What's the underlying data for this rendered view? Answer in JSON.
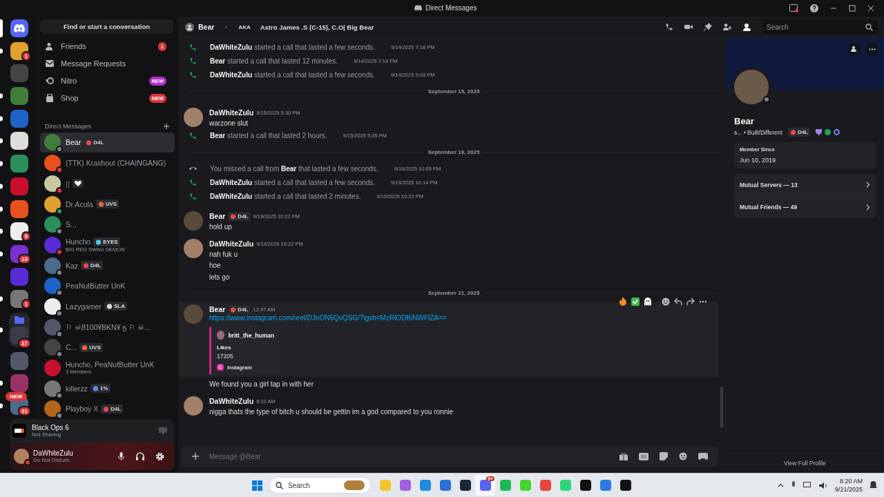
{
  "window": {
    "title": "Direct Messages"
  },
  "servers": {
    "items": [
      {
        "kind": "home",
        "selected": true,
        "unread": false
      },
      {
        "kind": "server",
        "selected": false,
        "unread": true,
        "badge": "1"
      },
      {
        "kind": "server",
        "selected": false,
        "unread": false
      },
      {
        "kind": "server",
        "selected": false,
        "unread": true
      },
      {
        "kind": "server",
        "selected": false,
        "unread": true
      },
      {
        "kind": "server",
        "selected": false,
        "unread": true
      },
      {
        "kind": "server",
        "selected": false,
        "unread": true
      },
      {
        "kind": "server",
        "selected": false,
        "unread": true
      },
      {
        "kind": "server",
        "selected": false,
        "unread": true
      },
      {
        "kind": "server",
        "selected": false,
        "unread": true,
        "badge": "5"
      },
      {
        "kind": "server",
        "selected": false,
        "unread": true,
        "badge": "10"
      },
      {
        "kind": "server",
        "selected": false,
        "unread": false
      },
      {
        "kind": "server",
        "selected": false,
        "unread": true,
        "badge": "1"
      },
      {
        "kind": "folder",
        "selected": false,
        "unread": true,
        "badge": "27"
      },
      {
        "kind": "server",
        "selected": false,
        "unread": false
      },
      {
        "kind": "server",
        "selected": false,
        "unread": true
      },
      {
        "kind": "server",
        "selected": false,
        "unread": true,
        "badge": "31"
      }
    ],
    "new_badge": "NEW"
  },
  "dm_panel": {
    "search": "Find or start a conversation",
    "nav": [
      {
        "kind": "friends",
        "label": "Friends",
        "badge": "1",
        "color": "#da373c"
      },
      {
        "kind": "requests",
        "label": "Message Requests"
      },
      {
        "kind": "nitro",
        "label": "Nitro",
        "badge": "NEW",
        "color": "#b02fc9"
      },
      {
        "kind": "shop",
        "label": "Shop",
        "badge": "NEW",
        "color": "#da373c"
      }
    ],
    "section_title": "Direct Messages",
    "dms": [
      {
        "name": "Bear",
        "tag": {
          "text": "D4L",
          "color": "#e8474f"
        },
        "color": "#80848e",
        "selected": true
      },
      {
        "name": "(TTK) Krashout (CHAINGANG)",
        "color": "#da373c",
        "selected": false
      },
      {
        "name": "▯",
        "tag": {
          "color": "#ffffff"
        },
        "color": "#da373c",
        "selected": false
      },
      {
        "name": "Dr.Acula",
        "tag": {
          "text": "UVS",
          "color": "#f0643c"
        },
        "color": "#23a55a",
        "selected": false
      },
      {
        "name": "S...",
        "color": "#80848e",
        "selected": false
      },
      {
        "name": "Huncho",
        "tag": {
          "text": "EYES",
          "color": "#4fc3f7"
        },
        "subtitle": "BIG RED SWAG DEMON",
        "color": "#da373c",
        "selected": false
      },
      {
        "name": "Kaz",
        "tag": {
          "text": "D4L",
          "color": "#e8474f"
        },
        "color": "#80848e",
        "selected": false
      },
      {
        "name": "PeaNutButter UnK",
        "color": "#80848e",
        "selected": false
      },
      {
        "name": "Lazygamer",
        "tag": {
          "text": "SLA",
          "color": "#dddddd"
        },
        "color": "#80848e",
        "selected": false
      },
      {
        "name": "⚐ ☠8100¥BKN¥ ӄ ⚐ ☠...",
        "color": "#80848e",
        "selected": false
      },
      {
        "name": "C...",
        "tag": {
          "text": "UVS",
          "color": "#f0643c"
        },
        "color": "#80848e",
        "selected": false
      },
      {
        "name": "Huncho, PeaNutButter UnK",
        "subtitle": "3 Members",
        "selected": false
      },
      {
        "name": "killerzz",
        "tag": {
          "text": "1%",
          "color": "#5b8def"
        },
        "color": "#80848e",
        "selected": false
      },
      {
        "name": "Playboy X",
        "tag": {
          "text": "D4L",
          "color": "#e8474f"
        },
        "color": "#80848e",
        "selected": false
      }
    ]
  },
  "activity": {
    "title": "Black Ops 6",
    "subtitle": "Not Sharing"
  },
  "user": {
    "name": "DaWhiteZulu",
    "status_text": "Do Not Disturb",
    "color": "#da373c"
  },
  "chat_header": {
    "name": "Bear",
    "aka": "AKA",
    "alias": "Astro James .S (C-15), C.O| Big Bear",
    "search_placeholder": "Search"
  },
  "messages": [
    {
      "kind": "call",
      "text": "**DaWhiteZulu** started a call that lasted a few seconds.",
      "time": "9/14/2025 7:18 PM",
      "missed": false
    },
    {
      "kind": "call",
      "text": "**Bear** started a call that lasted 12 minutes.",
      "time": "9/14/2025 7:18 PM",
      "missed": false
    },
    {
      "kind": "call",
      "text": "**DaWhiteZulu** started a call that lasted a few seconds.",
      "time": "9/14/2025 9:03 PM",
      "missed": false
    },
    {
      "kind": "divider",
      "text": "September 15, 2025"
    },
    {
      "kind": "message",
      "author": "DaWhiteZulu",
      "time": "9/15/2025 5:30 PM",
      "lines": [
        "warzone slut"
      ],
      "hovered": false
    },
    {
      "kind": "call",
      "text": "**Bear** started a call that lasted 2 hours.",
      "time": "9/15/2025 5:35 PM",
      "missed": false
    },
    {
      "kind": "divider",
      "text": "September 19, 2025"
    },
    {
      "kind": "call",
      "text": "You missed a call from **Bear** that lasted a few seconds.",
      "time": "9/19/2025 10:05 PM",
      "missed": true
    },
    {
      "kind": "call",
      "text": "**DaWhiteZulu** started a call that lasted a few seconds.",
      "time": "9/19/2025 10:14 PM",
      "missed": false
    },
    {
      "kind": "call",
      "text": "**DaWhiteZulu** started a call that lasted 2 minutes.",
      "time": "9/19/2025 10:22 PM",
      "missed": false
    },
    {
      "kind": "message",
      "author": "Bear",
      "tag": "D4L",
      "time": "9/19/2025 10:22 PM",
      "lines": [
        "hold up"
      ],
      "hovered": false
    },
    {
      "kind": "message",
      "author": "DaWhiteZulu",
      "time": "9/19/2025 10:22 PM",
      "lines": [
        "nah fuk u",
        "hoe",
        "lets go"
      ],
      "hovered": false
    },
    {
      "kind": "divider",
      "text": "September 21, 2025"
    },
    {
      "kind": "message",
      "author": "Bear",
      "tag": "D4L",
      "time": "12:47 AM",
      "link": "https://www.instagram.com/reel/DJnON5QvQSG/?igsh=MzRlODBiNWFlZA==",
      "embed": {
        "author": "britt_the_human",
        "field_name": "Likes",
        "field_value": "17205",
        "provider": "Instagram"
      },
      "hovered": true
    },
    {
      "kind": "continuation",
      "text": "We found you a girl tap in with her"
    },
    {
      "kind": "message",
      "author": "DaWhiteZulu",
      "time": "8:10 AM",
      "lines": [
        "nigga thats the type of bitch u should be gettin im a god compared to you ronnie"
      ],
      "hovered": false
    }
  ],
  "composer": {
    "placeholder": "Message @Bear"
  },
  "profile": {
    "name": "Bear",
    "subtitle": "s... • Built/Different",
    "tag": "D4L",
    "member_since_label": "Member Since",
    "member_since": "Jun 10, 2019",
    "rows": [
      "Mutual Servers — 13",
      "Mutual Friends — 49"
    ],
    "footer": "View Full Profile"
  },
  "taskbar": {
    "search": "Search",
    "apps": [
      {
        "selected": false
      },
      {
        "selected": false
      },
      {
        "selected": false
      },
      {
        "selected": false
      },
      {
        "selected": false
      },
      {
        "badge": "9+",
        "selected": true
      },
      {
        "selected": false
      },
      {
        "selected": false
      },
      {
        "selected": false
      },
      {
        "selected": false
      },
      {
        "selected": false
      },
      {
        "selected": false
      },
      {
        "selected": false
      }
    ],
    "time": "8:20 AM",
    "date": "9/21/2025"
  }
}
